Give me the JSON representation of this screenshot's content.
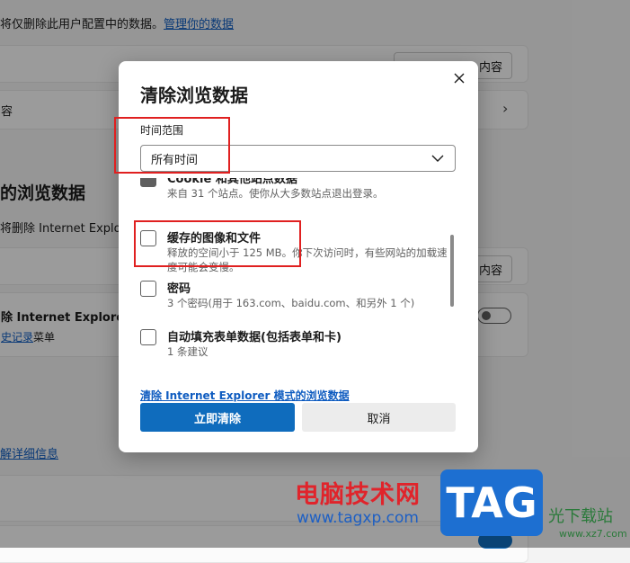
{
  "background": {
    "top_note": "将仅删除此用户配置中的数据。",
    "top_link": "管理你的数据",
    "card1_btn": "内容",
    "card2_text": "容",
    "section_heading": "的浏览数据",
    "section_desc": "将删除 Internet Explo",
    "card3_btn": "内容",
    "ie_row_title": "除 Internet Explorer",
    "ie_row_link": "史记录",
    "ie_row_suffix": "菜单",
    "learn_more": "解详细信息"
  },
  "dialog": {
    "title": "清除浏览数据",
    "time_range_label": "时间范围",
    "time_range_value": "所有时间",
    "items": [
      {
        "title": "Cookie 和其他站点数据",
        "desc": "来自 31 个站点。使你从大多数站点退出登录。",
        "checked": true
      },
      {
        "title": "缓存的图像和文件",
        "desc": "释放的空间小于 125 MB。你下次访问时，有些网站的加载速度可能会变慢。",
        "checked": false
      },
      {
        "title": "密码",
        "desc": "3 个密码(用于 163.com、baidu.com、和另外 1 个)",
        "checked": false
      },
      {
        "title": "自动填充表单数据(包括表单和卡)",
        "desc": "1 条建议",
        "checked": false
      }
    ],
    "ie_link": "清除 Internet Explorer 模式的浏览数据",
    "clear_button": "立即清除",
    "cancel_button": "取消"
  },
  "watermark": {
    "cn": "电脑技术网",
    "url": "www.tagxp.com",
    "tag": "TAG",
    "site": "光下载站",
    "site_url": "www.xz7.com"
  },
  "colors": {
    "accent": "#0f6cbd",
    "highlight": "#e02020"
  }
}
